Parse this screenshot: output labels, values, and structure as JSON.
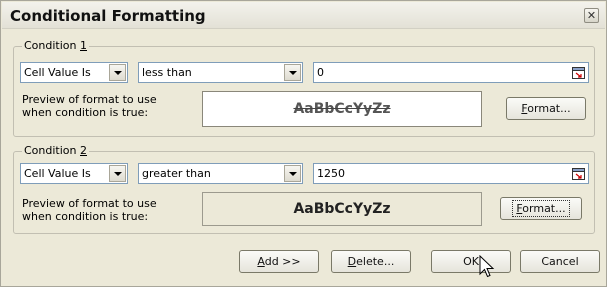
{
  "window": {
    "title": "Conditional Formatting"
  },
  "condition1": {
    "label_prefix": "Condition ",
    "label_num": "1",
    "type": "Cell Value Is",
    "operator": "less than",
    "value": "0",
    "preview_label_line1": "Preview of format to use",
    "preview_label_line2": "when condition is true:",
    "preview_sample": "AaBbCcYyZz",
    "format_prefix": "",
    "format_underline": "F",
    "format_rest": "ormat..."
  },
  "condition2": {
    "label_prefix": "Condition ",
    "label_num": "2",
    "type": "Cell Value Is",
    "operator": "greater than",
    "value": "1250",
    "preview_label_line1": "Preview of format to use",
    "preview_label_line2": "when condition is true:",
    "preview_sample": "AaBbCcYyZz",
    "format_underline": "F",
    "format_rest": "ormat..."
  },
  "buttons": {
    "add_underline": "A",
    "add_rest": "dd >>",
    "delete_underline": "D",
    "delete_rest": "elete...",
    "ok": "OK",
    "cancel": "Cancel"
  }
}
